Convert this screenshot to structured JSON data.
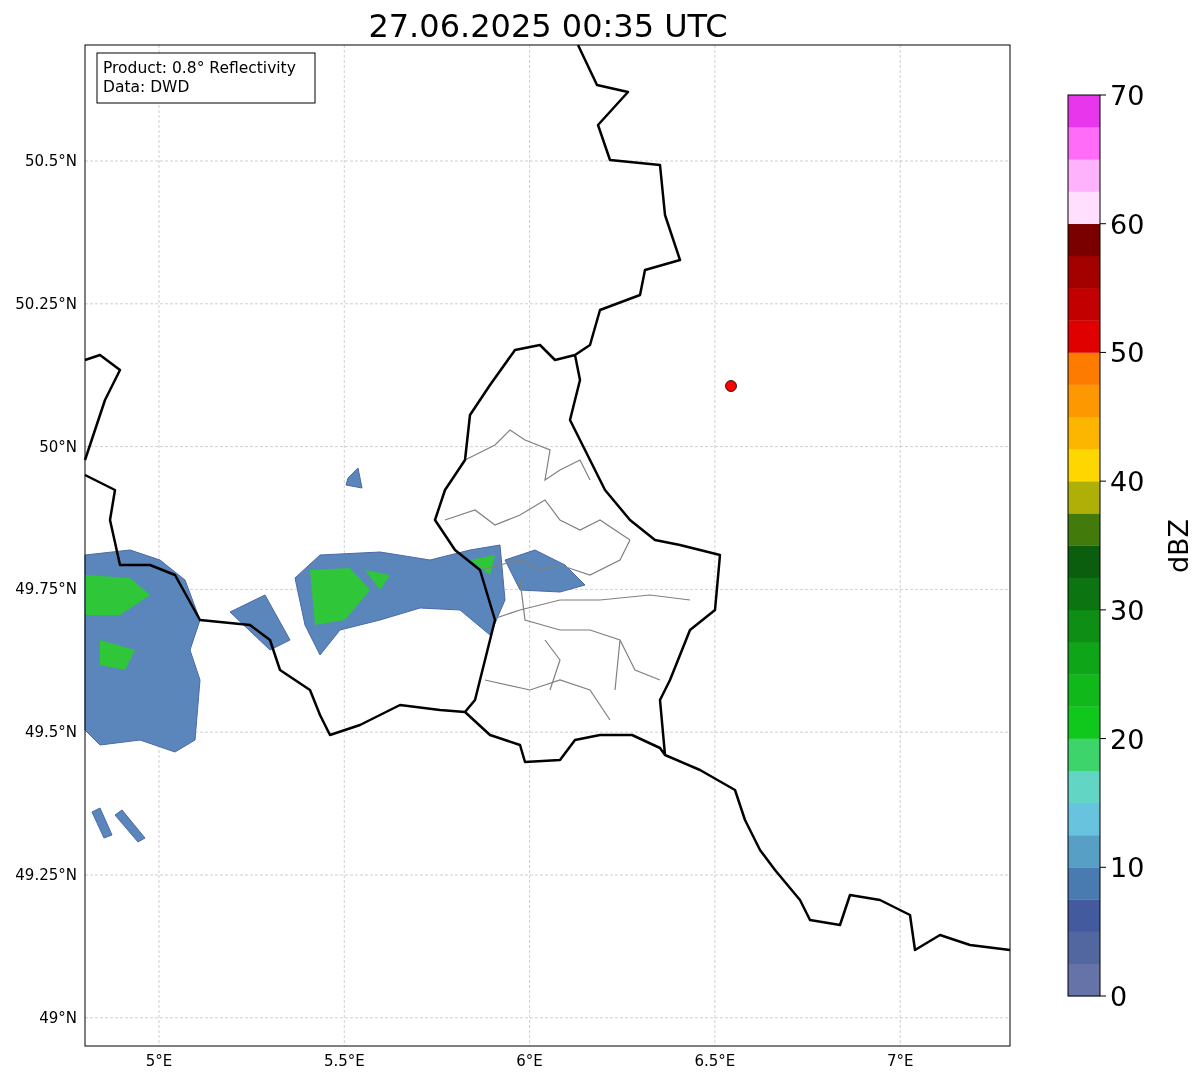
{
  "title": "27.06.2025 00:35 UTC",
  "info_box": [
    "Product: 0.8° Reflectivity",
    "Data: DWD"
  ],
  "map": {
    "y_ticks": [
      "50.5°N",
      "50.25°N",
      "50°N",
      "49.75°N",
      "49.5°N",
      "49.25°N",
      "49°N"
    ],
    "x_ticks": [
      "5°E",
      "5.5°E",
      "6°E",
      "6.5°E",
      "7°E"
    ]
  },
  "colorbar": {
    "label": "dBZ",
    "ticks": [
      "70",
      "60",
      "50",
      "40",
      "30",
      "20",
      "10",
      "0"
    ],
    "segments": [
      {
        "color": "#6673a8"
      },
      {
        "color": "#52679f"
      },
      {
        "color": "#435a9e"
      },
      {
        "color": "#4a7bb0"
      },
      {
        "color": "#589fc6"
      },
      {
        "color": "#67c3de"
      },
      {
        "color": "#62d5c4"
      },
      {
        "color": "#3dd46c"
      },
      {
        "color": "#10c81b"
      },
      {
        "color": "#10b81a"
      },
      {
        "color": "#0fa518"
      },
      {
        "color": "#0e8e14"
      },
      {
        "color": "#0c7411"
      },
      {
        "color": "#0a5e0e"
      },
      {
        "color": "#427a0c"
      },
      {
        "color": "#aeb007"
      },
      {
        "color": "#fed700"
      },
      {
        "color": "#fdb600"
      },
      {
        "color": "#fd9800"
      },
      {
        "color": "#fd7c00"
      },
      {
        "color": "#e00000"
      },
      {
        "color": "#c20000"
      },
      {
        "color": "#a30000"
      },
      {
        "color": "#7a0000"
      },
      {
        "color": "#ffdefe"
      },
      {
        "color": "#ffb2fc"
      },
      {
        "color": "#ff6cf8"
      },
      {
        "color": "#e836ec"
      }
    ]
  }
}
